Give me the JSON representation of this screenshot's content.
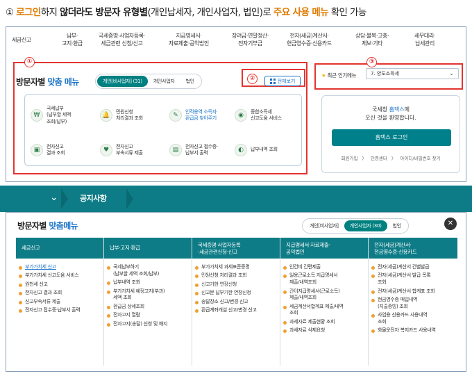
{
  "heading": {
    "num": "①",
    "p1": "로그인",
    "p2": "하지 ",
    "p3": "않더라도 방문자 유형별",
    "p4": "(개인납세자, 개인사업자, 법인)로 ",
    "p5": "주요 사용 메뉴",
    "p6": " 확인 가능"
  },
  "gnb": [
    {
      "l1": "세금신고",
      "l2": ""
    },
    {
      "l1": "납부·",
      "l2": "고지·환급"
    },
    {
      "l1": "국세증명·사업자등록·",
      "l2": "세금관련 신청/신고"
    },
    {
      "l1": "지급명세서·",
      "l2": "자료제출·공익법인"
    },
    {
      "l1": "장려금·연말정산·",
      "l2": "전자기부금"
    },
    {
      "l1": "전자(세금)계산서·",
      "l2": "현금영수증·신용카드"
    },
    {
      "l1": "상담·불복·고충·",
      "l2": "제보·기타"
    },
    {
      "l1": "세무대리·",
      "l2": "납세관리"
    }
  ],
  "callouts": [
    "①",
    "②",
    "③"
  ],
  "visitor_menu": {
    "title_a": "방문자별 ",
    "title_b": "맞춤 메뉴",
    "tabs": [
      "개인[비사업자] (31)",
      "개인사업자",
      "법인"
    ],
    "view_all": "전체보기",
    "items": [
      {
        "l1": "국세납부",
        "l2": "(납부할 세액",
        "l3": "조회/납부)",
        "icon": "₩"
      },
      {
        "l1": "민원신청",
        "l2": "처리결과 조회",
        "l3": "",
        "icon": "🔔"
      },
      {
        "l1": "인적용역 소득자",
        "l2": "환급금 찾아주기",
        "l3": "",
        "icon": "✎"
      },
      {
        "l1": "종합소득세",
        "l2": "신고도움 서비스",
        "l3": "",
        "icon": "◉"
      },
      {
        "l1": "전자신고",
        "l2": "결과 조회",
        "l3": "",
        "icon": "▣"
      },
      {
        "l1": "전자신고",
        "l2": "부속서류 제출",
        "l3": "",
        "icon": "♥"
      },
      {
        "l1": "전자신고 접수증·",
        "l2": "납부서 출력",
        "l3": "",
        "icon": "▤"
      },
      {
        "l1": "납부내역 조회",
        "l2": "",
        "l3": "",
        "icon": "◐"
      }
    ]
  },
  "popular": {
    "label": "최근 인기메뉴",
    "selected": "7. 양도소득세",
    "arrow": "⌄",
    "star": "★"
  },
  "login": {
    "welcome_a": "국세청 ",
    "welcome_b": "홈택스",
    "welcome_c": "에",
    "welcome_line2": "오신 것을 환영합니다.",
    "button": "홈택스 로그인",
    "links": [
      "회원가입",
      "〉",
      "인증센터",
      "〉",
      "아이디/비밀번호 찾기"
    ]
  },
  "band": {
    "chevron": "⌄",
    "notice": "공지사항"
  },
  "full_menu": {
    "title_a": "방문자별 ",
    "title_b": "맞춤메뉴",
    "tabs": [
      "개인[비사업자]",
      "개인사업자 (30)",
      "법인"
    ],
    "close": "✕",
    "columns": [
      {
        "h1": "세금신고",
        "h2": "",
        "items": [
          {
            "l1": "부가가치세 신고",
            "l2": ""
          },
          {
            "l1": "부가가치세 신고도움 서비스",
            "l2": ""
          },
          {
            "l1": "원천세 신고",
            "l2": ""
          },
          {
            "l1": "전자신고 결과 조회",
            "l2": ""
          },
          {
            "l1": "신고부속서류 제출",
            "l2": ""
          },
          {
            "l1": "전자신고 접수증·납부서 출력",
            "l2": ""
          }
        ]
      },
      {
        "h1": "납부·고지·환급",
        "h2": "",
        "items": [
          {
            "l1": "국세납부하기",
            "l2": "(납부할 세액 조회/납부)"
          },
          {
            "l1": "납부내역 조회",
            "l2": ""
          },
          {
            "l1": "부가가치세 예정고지(부과)",
            "l2": "세액 조회"
          },
          {
            "l1": "환급금 상세조회",
            "l2": ""
          },
          {
            "l1": "전자고지 열람",
            "l2": ""
          },
          {
            "l1": "전자고지(송달) 신청 및 해지",
            "l2": ""
          }
        ]
      },
      {
        "h1": "국세증명·사업자등록",
        "h2": "·세금관련신청·신고",
        "items": [
          {
            "l1": "부가가치세 과세표준증명",
            "l2": ""
          },
          {
            "l1": "민원신청 처리결과 조회",
            "l2": ""
          },
          {
            "l1": "신고기한 연장신청",
            "l2": ""
          },
          {
            "l1": "신고분 납부기한 연장신청",
            "l2": ""
          },
          {
            "l1": "송달장소 신고/변경 신고",
            "l2": ""
          },
          {
            "l1": "환급계좌개설 신고/변경 신고",
            "l2": ""
          }
        ]
      },
      {
        "h1": "지급명세서·자료제출·",
        "h2": "공익법인",
        "items": [
          {
            "l1": "인건비 간편제출",
            "l2": ""
          },
          {
            "l1": "일용근로소득 지급명세서",
            "l2": "제출/내역조회"
          },
          {
            "l1": "간이지급명세서(근로소득)",
            "l2": "제출/내역조회"
          },
          {
            "l1": "세금계산서합계표 제출/내역",
            "l2": "조회"
          },
          {
            "l1": "과세자료 제출현황 조회",
            "l2": ""
          },
          {
            "l1": "과세자료 삭제요청",
            "l2": ""
          }
        ]
      },
      {
        "h1": "전자(세금)계산서·",
        "h2": "현금영수증·신용카드",
        "items": [
          {
            "l1": "전자(세금)계산서 건별발급",
            "l2": ""
          },
          {
            "l1": "전자(세금)계산서 발급 목록",
            "l2": "조회"
          },
          {
            "l1": "전자(세금)계산서 합계표 조회",
            "l2": ""
          },
          {
            "l1": "현금영수증 매입내역",
            "l2": "(지출증빙) 조회"
          },
          {
            "l1": "사업용 신용카드 사용내역",
            "l2": "조회"
          },
          {
            "l1": "화물운전자 복지카드 사용내역",
            "l2": ""
          }
        ]
      }
    ]
  }
}
